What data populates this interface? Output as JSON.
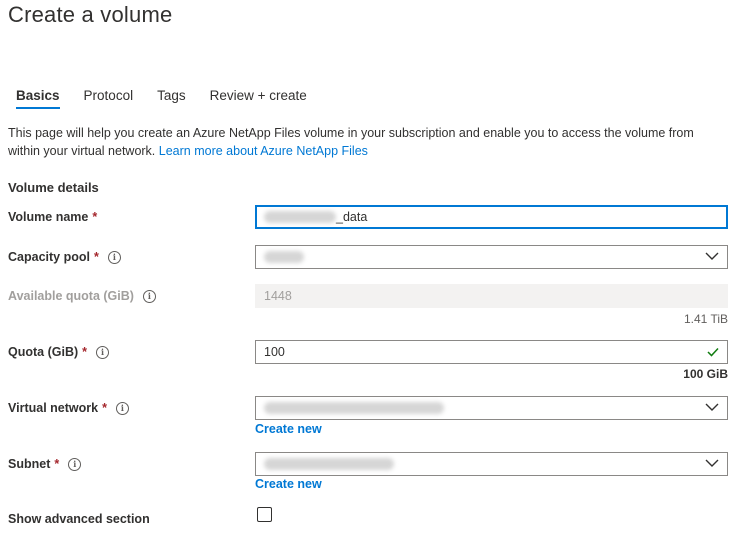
{
  "page": {
    "title": "Create a volume"
  },
  "tabs": [
    {
      "label": "Basics",
      "active": true
    },
    {
      "label": "Protocol",
      "active": false
    },
    {
      "label": "Tags",
      "active": false
    },
    {
      "label": "Review + create",
      "active": false
    }
  ],
  "intro": {
    "text": "This page will help you create an Azure NetApp Files volume in your subscription and enable you to access the volume from within your virtual network.",
    "link_text": "Learn more about Azure NetApp Files"
  },
  "section": {
    "heading": "Volume details"
  },
  "fields": {
    "volume_name": {
      "label": "Volume name",
      "required_mark": "*",
      "value_suffix": "_data"
    },
    "capacity_pool": {
      "label": "Capacity pool",
      "required_mark": "*",
      "info_icon": "info-icon"
    },
    "available_quota": {
      "label": "Available quota (GiB)",
      "info_icon": "info-icon",
      "value": "1448",
      "converted": "1.41 TiB"
    },
    "quota": {
      "label": "Quota (GiB)",
      "required_mark": "*",
      "info_icon": "info-icon",
      "value": "100",
      "converted": "100 GiB",
      "valid_icon": "checkmark-icon"
    },
    "virtual_network": {
      "label": "Virtual network",
      "required_mark": "*",
      "info_icon": "info-icon",
      "create_new": "Create new"
    },
    "subnet": {
      "label": "Subnet",
      "required_mark": "*",
      "info_icon": "info-icon",
      "create_new": "Create new"
    },
    "advanced": {
      "label": "Show advanced section",
      "checked": false
    }
  },
  "colors": {
    "accent": "#0078d4",
    "required": "#a4262c",
    "valid": "#107c10",
    "text": "#323130",
    "disabled_bg": "#f3f2f1"
  }
}
